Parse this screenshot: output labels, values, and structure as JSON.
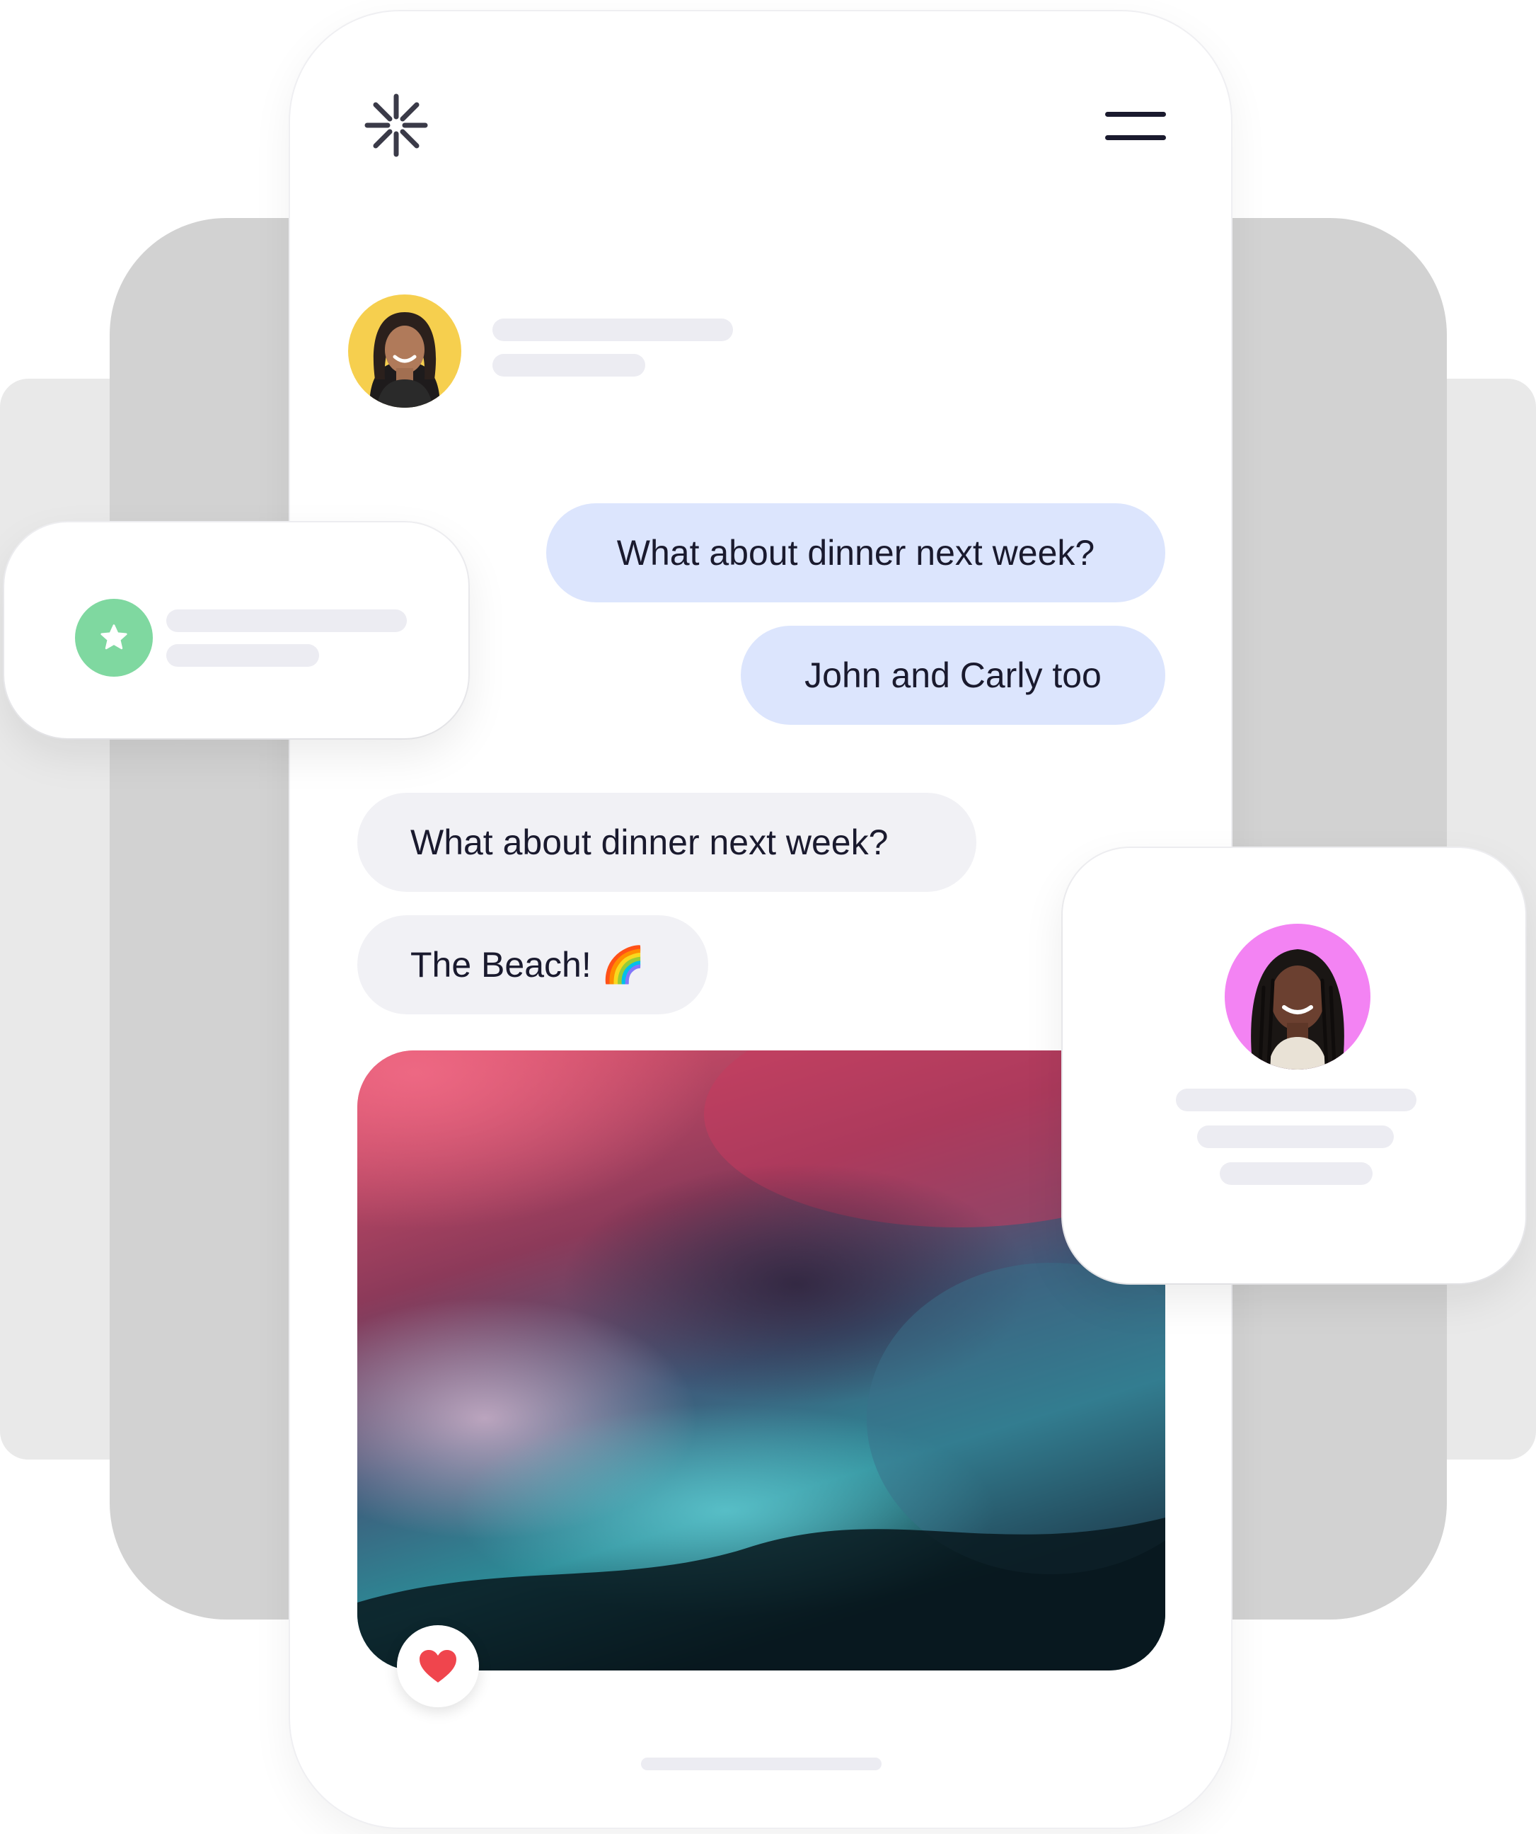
{
  "colors": {
    "outgoing_bubble": "#dce5fd",
    "incoming_bubble": "#f1f1f5",
    "avatar_yellow": "#f6cf4e",
    "avatar_pink": "#f383f3",
    "star_badge": "#7fd8a0",
    "heart": "#f0454d",
    "text": "#1a1a2e"
  },
  "header": {
    "logo_icon": "asterisk-logo-icon",
    "menu_icon": "hamburger-menu-icon"
  },
  "contact": {
    "avatar_icon": "woman-portrait-avatar"
  },
  "messages": {
    "outgoing": [
      "What about dinner next week?",
      "John and Carly too"
    ],
    "incoming": [
      "What about dinner next week?",
      "The Beach! 🌈"
    ]
  },
  "media": {
    "image_icon": "abstract-ink-image",
    "like_icon": "heart-icon"
  },
  "notification_card": {
    "icon": "star-icon"
  },
  "profile_card": {
    "avatar_icon": "woman-braids-portrait-avatar"
  }
}
